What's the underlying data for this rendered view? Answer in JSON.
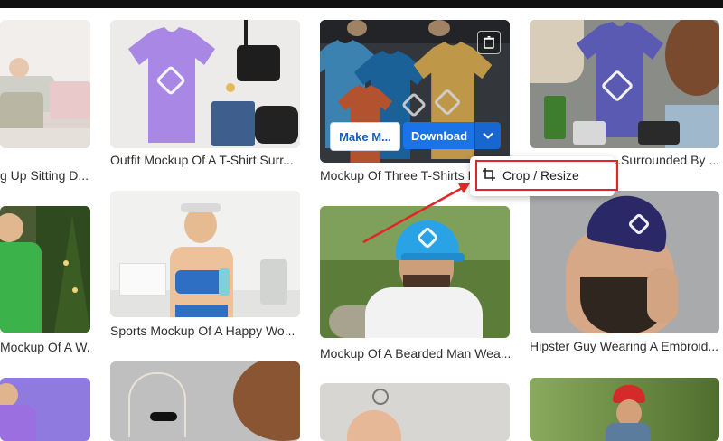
{
  "cards": [
    {
      "caption": "g Up Sitting D..."
    },
    {
      "caption": "Outfit Mockup Of A T-Shirt Surr..."
    },
    {
      "caption": "Mockup Of Three T-Shirts Ly"
    },
    {
      "caption": "...Surrounded By ..."
    },
    {
      "caption": "Mockup Of A W..."
    },
    {
      "caption": "Sports Mockup Of A Happy Wo..."
    },
    {
      "caption": "Mockup Of A Bearded Man Wea..."
    },
    {
      "caption": "Hipster Guy Wearing A Embroid..."
    }
  ],
  "overlay": {
    "make_label": "Make M...",
    "download_label": "Download",
    "dropdown_icon": "chevron-down-icon",
    "delete_icon": "trash-icon"
  },
  "dropdown_menu": {
    "items": [
      {
        "label": "Crop / Resize",
        "icon": "crop-icon"
      }
    ],
    "highlight_color": "#e02626"
  },
  "colors": {
    "download": "#1a73e8",
    "annotation": "#e02626"
  }
}
